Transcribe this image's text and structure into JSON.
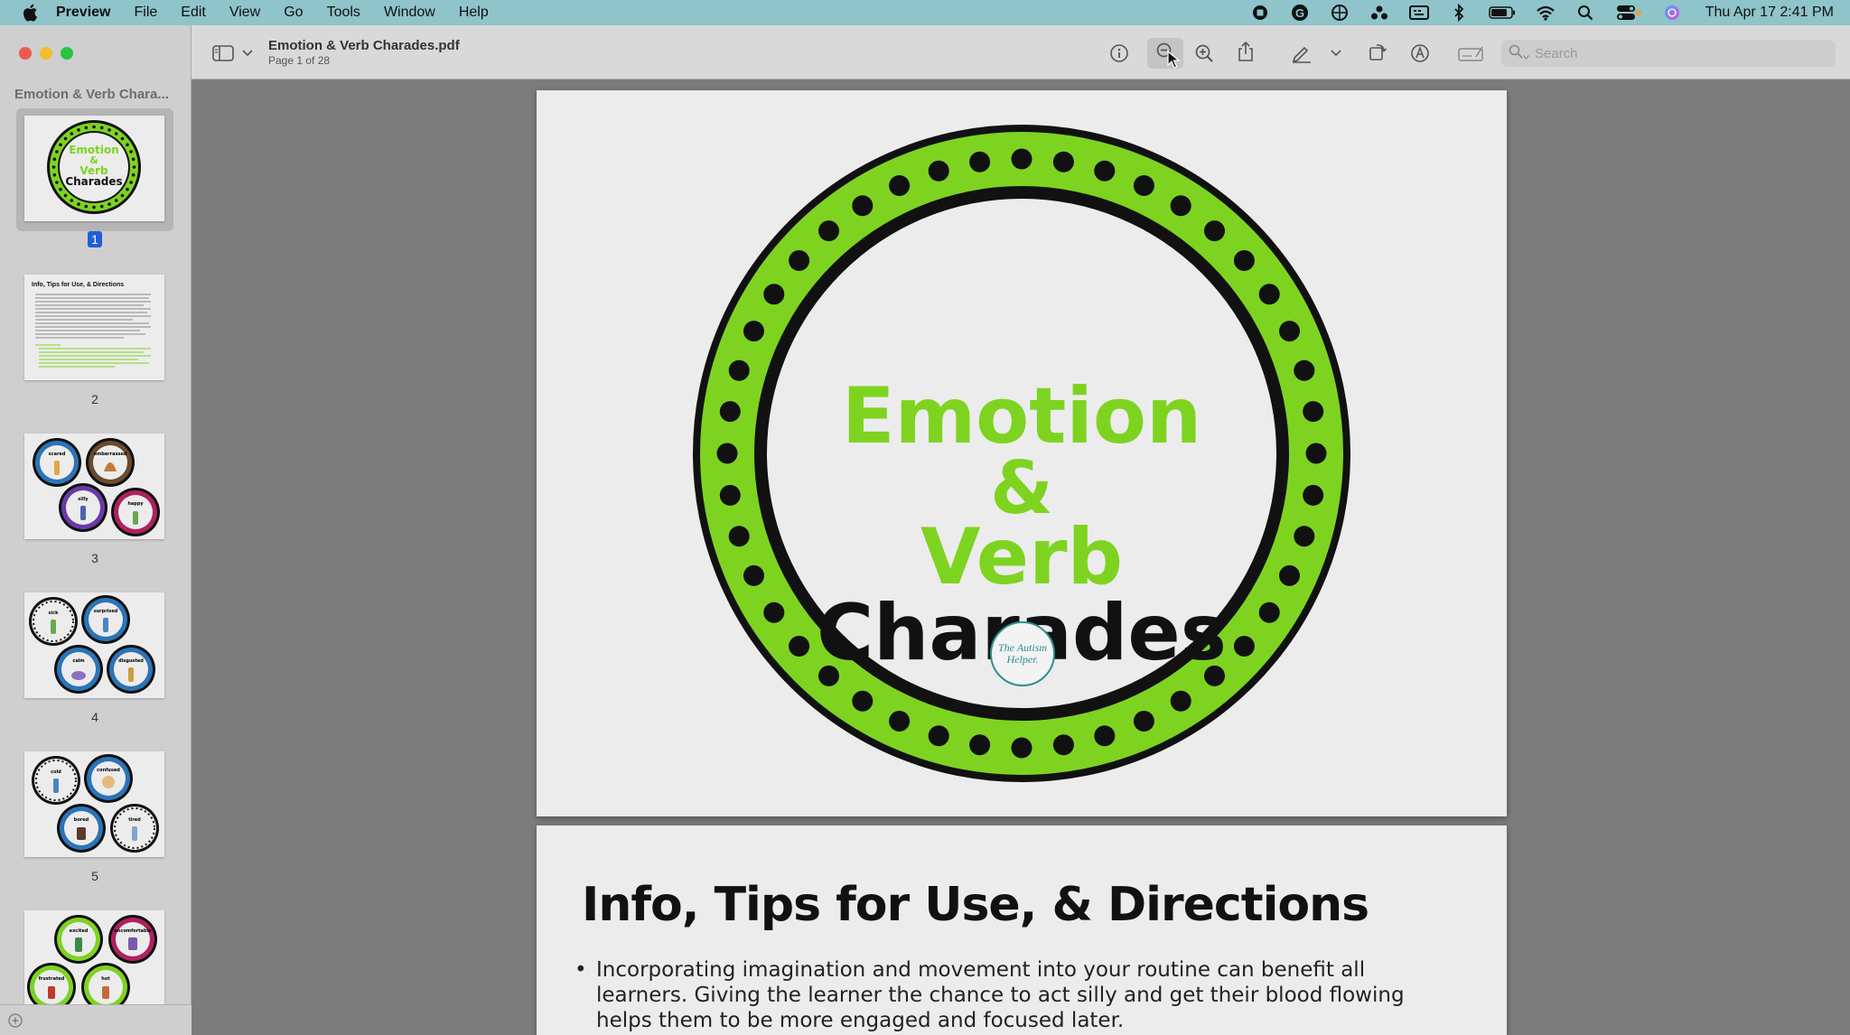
{
  "menubar": {
    "app_name": "Preview",
    "items": [
      "File",
      "Edit",
      "View",
      "Go",
      "Tools",
      "Window",
      "Help"
    ],
    "clock": "Thu Apr 17  2:41 PM",
    "status_icons": [
      "screen-record-icon",
      "grammarly-icon",
      "vpn-icon",
      "dropbox-icon",
      "keyboard-icon",
      "bluetooth-icon",
      "battery-icon",
      "wifi-icon",
      "spotlight-search-icon",
      "control-center-icon",
      "siri-icon"
    ]
  },
  "sidebar": {
    "title": "Emotion & Verb Chara...",
    "thumbnails": [
      {
        "page": "1",
        "selected": true
      },
      {
        "page": "2",
        "selected": false
      },
      {
        "page": "3",
        "selected": false
      },
      {
        "page": "4",
        "selected": false
      },
      {
        "page": "5",
        "selected": false
      },
      {
        "page": "6",
        "selected": false
      }
    ]
  },
  "toolbar": {
    "doc_title": "Emotion & Verb Charades.pdf",
    "page_indicator": "Page 1 of 28",
    "search_placeholder": "Search",
    "icons": [
      "sidebar-toggle-icon",
      "info-icon",
      "zoom-out-icon",
      "zoom-in-icon",
      "share-icon",
      "markup-pen-icon",
      "rotate-icon",
      "annotate-icon",
      "form-icon"
    ]
  },
  "document": {
    "cover": {
      "line1": "Emotion",
      "line2": "&",
      "line3": "Verb",
      "line4": "Charades",
      "logo_text": "The Autism Helper.",
      "accent_color": "#7ed321",
      "ring_color": "#1a1a1a"
    },
    "page2": {
      "heading": "Info, Tips for Use, & Directions",
      "bullet1": "Incorporating imagination and movement into your routine can benefit all learners. Giving the learner the chance to act silly and get their blood flowing helps them to be more engaged and focused later."
    }
  },
  "thumb_text": {
    "p2_heading": "Info, Tips for Use, & Directions",
    "p3_labels": [
      "scared",
      "embarrassed",
      "silly",
      "happy"
    ],
    "p4_labels": [
      "sick",
      "surprised",
      "calm",
      "disgusted"
    ],
    "p5_labels": [
      "cold",
      "confused",
      "bored",
      "tired"
    ],
    "p6_labels": [
      "excited",
      "uncomfortable",
      "frustrated",
      "hot"
    ]
  }
}
